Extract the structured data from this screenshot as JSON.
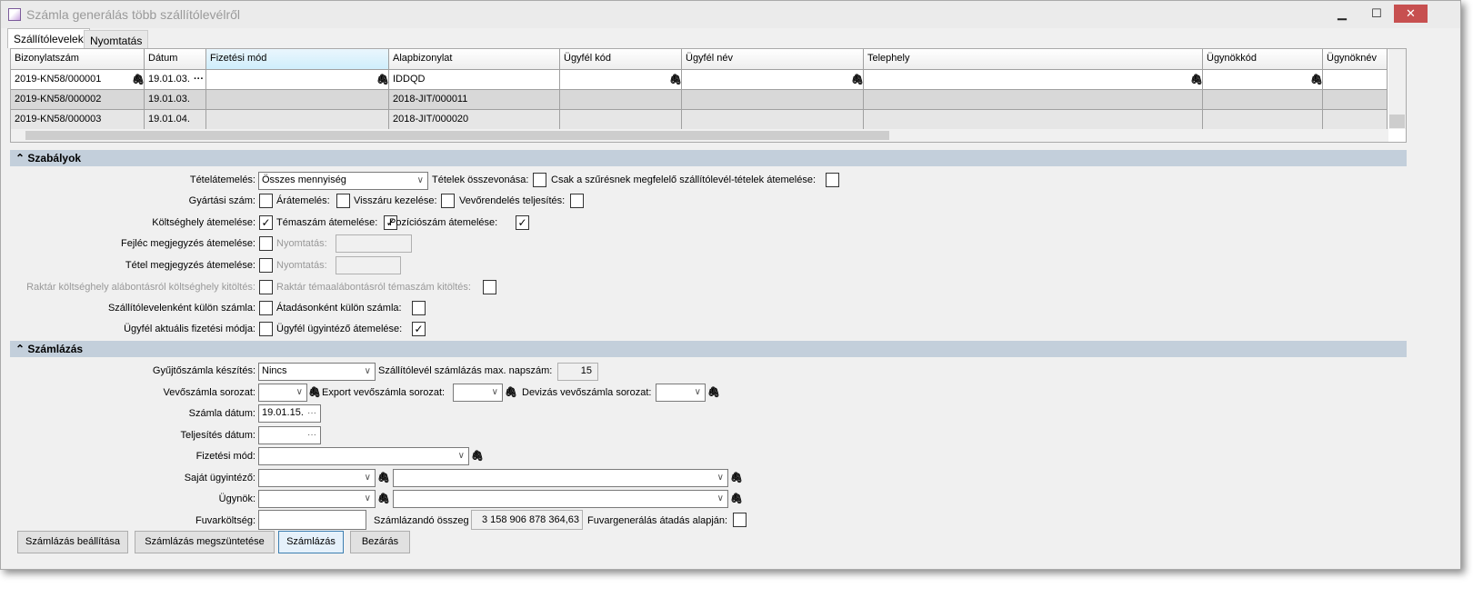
{
  "window": {
    "title": "Számla generálás több szállítólevélről",
    "minimize": "▁",
    "maximize": "☐",
    "close": "✕"
  },
  "tabs": [
    "Szállítólevelek",
    "Nyomtatás"
  ],
  "grid": {
    "columns": [
      "Bizonylatszám",
      "Dátum",
      "Fizetési mód",
      "Alapbizonylat",
      "Ügyfél kód",
      "Ügyfél név",
      "Telephely",
      "Ügynökkód",
      "Ügynöknév"
    ],
    "rows": [
      [
        "2019-KN58/000001",
        "19.01.03.",
        "",
        "IDDQD",
        "",
        "",
        "",
        "",
        ""
      ],
      [
        "2019-KN58/000002",
        "19.01.03.",
        "",
        "2018-JIT/000011",
        "",
        "",
        "",
        "",
        ""
      ],
      [
        "2019-KN58/000003",
        "19.01.04.",
        "",
        "2018-JIT/000020",
        "",
        "",
        "",
        "",
        ""
      ]
    ]
  },
  "rules": {
    "header": "Szabályok",
    "tetelatemeles": "Tételátemelés:",
    "tetelatemeles_value": "Összes mennyiség",
    "tetelek_osszevonasa": "Tételek összevonása:",
    "csak_szures": "Csak a szűrésnek megfelelő szállítólevél-tételek átemelése:",
    "gyartasi_szam": "Gyártási szám:",
    "aratemeles": "Árátemelés:",
    "visszaru": "Visszáru kezelése:",
    "vevorendeles": "Vevőrendelés teljesítés:",
    "koltseghely": "Költséghely átemelése:",
    "temaszam": "Témaszám átemelése:",
    "pozicioszam": "Pozíciószám átemelése:",
    "fejlec_megj": "Fejléc megjegyzés átemelése:",
    "nyomtatas": "Nyomtatás:",
    "tetel_megj": "Tétel megjegyzés átemelése:",
    "raktar_koltseghely": "Raktár költséghely alábontásról költséghely kitöltés:",
    "raktar_tema": "Raktár témaalábontásról témaszám kitöltés:",
    "szallitolevelenkent": "Szállítólevelenként külön számla:",
    "atadasonkent": "Átadásonként külön számla:",
    "ugyfel_fizetesi": "Ügyfél aktuális fizetési módja:",
    "ugyfel_ugyintezo": "Ügyfél ügyintéző átemelése:",
    "checked": {
      "koltseghely": true,
      "temaszam": true,
      "pozicioszam": true,
      "ugyfel_ugyintezo": true
    }
  },
  "billing": {
    "header": "Számlázás",
    "gyujtoszamla": "Gyűjtőszámla készítés:",
    "gyujtoszamla_value": "Nincs",
    "max_napszam": "Szállítólevél számlázás max. napszám:",
    "max_napszam_value": "15",
    "vevoszamla": "Vevőszámla sorozat:",
    "export": "Export vevőszámla sorozat:",
    "devizas": "Devizás vevőszámla sorozat:",
    "szamla_datum": "Számla dátum:",
    "szamla_datum_value": "19.01.15.",
    "teljesites": "Teljesítés dátum:",
    "fizetesi_mod": "Fizetési mód:",
    "sajat_ugyintezo": "Saját ügyintéző:",
    "ugynok": "Ügynök:",
    "fuvarkoltseg": "Fuvarköltség:",
    "szamlazando": "Számlázandó összeg",
    "szamlazando_value": "3 158 906 878 364,63",
    "fuvargeneralas": "Fuvargenerálás átadás alapján:"
  },
  "buttons": {
    "beallitas": "Számlázás beállítása",
    "megszuntetes": "Számlázás megszüntetése",
    "szamlazas": "Számlázás",
    "bezaras": "Bezárás"
  },
  "icons": {
    "clip": "🖇",
    "ellipsis": "···",
    "chevron": "∨",
    "check": "✓",
    "collapse": "^"
  }
}
